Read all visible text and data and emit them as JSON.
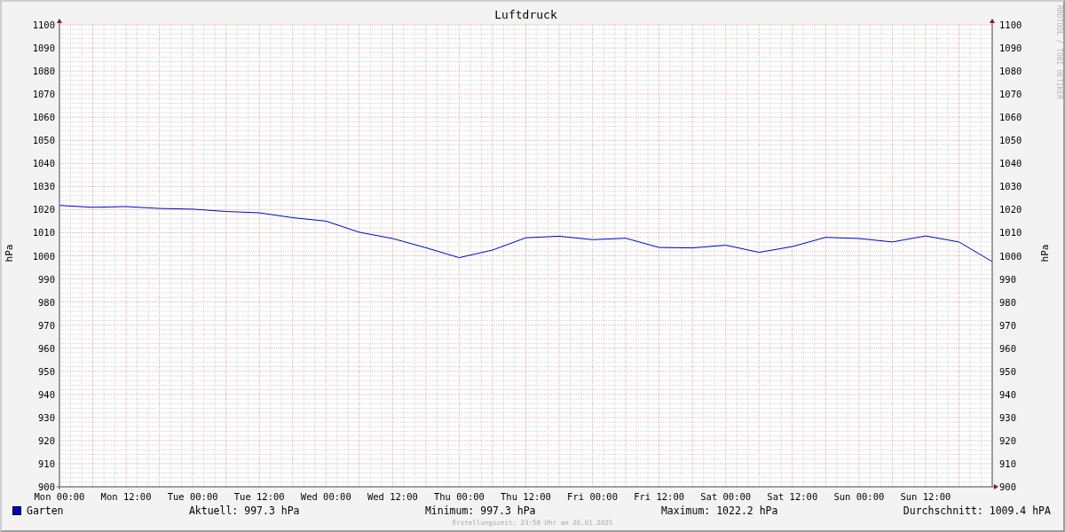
{
  "chart_data": {
    "type": "line",
    "title": "Luftdruck",
    "ylabel": "hPa",
    "grid": true,
    "ylim": [
      900,
      1100
    ],
    "categories": [
      "Mon 00:00",
      null,
      "Mon 12:00",
      null,
      "Tue 00:00",
      null,
      "Tue 12:00",
      null,
      "Wed 00:00",
      null,
      "Wed 12:00",
      null,
      "Thu 00:00",
      null,
      "Thu 12:00",
      null,
      "Fri 00:00",
      null,
      "Fri 12:00",
      null,
      "Sat 00:00",
      null,
      "Sat 12:00",
      null,
      "Sun 00:00",
      null,
      "Sun 12:00",
      null,
      null
    ],
    "series": [
      {
        "name": "Garten",
        "color": "#0000cc",
        "values": [
          1021.8,
          1021,
          1021.3,
          1020.5,
          1020.2,
          1019.2,
          1018.6,
          1016.5,
          1015,
          1010.2,
          1007.5,
          1003.5,
          999.2,
          1002.5,
          1007.8,
          1008.5,
          1007,
          1007.6,
          1003.6,
          1003.4,
          1004.6,
          1001.5,
          1004,
          1008,
          1007.5,
          1006,
          1008.6,
          1006,
          997.5
        ]
      }
    ],
    "yticks": [
      900,
      910,
      920,
      930,
      940,
      950,
      960,
      970,
      980,
      990,
      1000,
      1010,
      1020,
      1030,
      1040,
      1050,
      1060,
      1070,
      1080,
      1090,
      1100
    ]
  },
  "right_axis": {
    "label": "hPa",
    "ticks": [
      "1100",
      "1090",
      "1080",
      "1070",
      "1060",
      "1050",
      "1040",
      "1030",
      "1020",
      "1010",
      "1000",
      "990",
      "980",
      "970",
      "960",
      "950",
      "940",
      "930",
      "920",
      "910",
      "900"
    ]
  },
  "side_label": "RRDTOOL / TOBI OETIKER",
  "legend_stats": [
    "Aktuell: 997.3 hPa",
    "Minimum: 997.3 hPa",
    "Maximum: 1022.2 hPa",
    "Durchschnitt: 1009.4 hPA"
  ],
  "footer": "Erstellungszeit: 23:58 Uhr am 26.01.2025"
}
